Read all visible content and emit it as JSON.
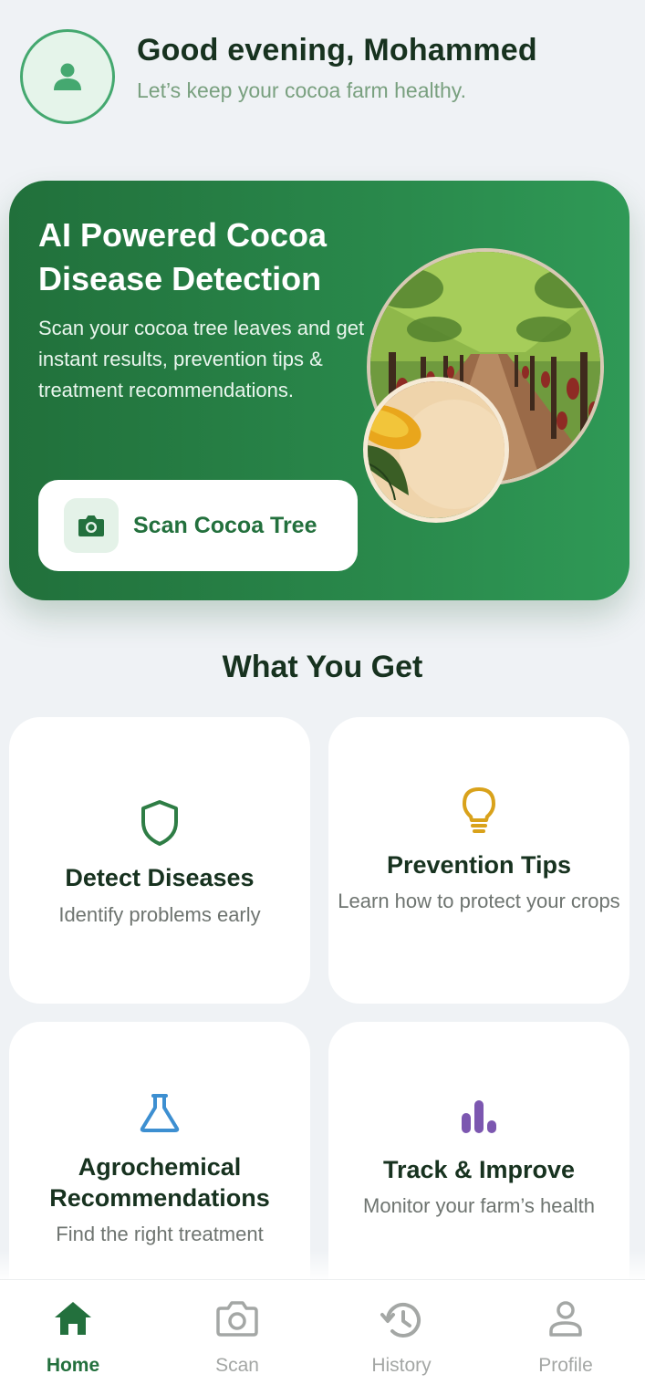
{
  "header": {
    "greeting": "Good evening, Mohammed",
    "subtitle": "Let’s keep your cocoa farm healthy.",
    "avatar_icon": "user-icon"
  },
  "hero": {
    "title_line1": "AI Powered Cocoa",
    "title_line2": "Disease Detection",
    "description": "Scan your cocoa tree leaves and get instant results, prevention tips & treatment recommendations.",
    "button_label": "Scan Cocoa Tree",
    "button_icon": "camera-icon",
    "colors": {
      "gradient_start": "#21703b",
      "gradient_end": "#2f9956"
    }
  },
  "features": {
    "title": "What You Get",
    "cards": [
      {
        "icon": "shield-icon",
        "icon_color": "#2e7d45",
        "title": "Detect Diseases",
        "description": "Identify problems early"
      },
      {
        "icon": "lightbulb-icon",
        "icon_color": "#d9a21b",
        "title": "Prevention Tips",
        "description": "Learn how to protect your crops"
      },
      {
        "icon": "flask-icon",
        "icon_color": "#3d8fd1",
        "title_line1": "Agrochemical",
        "title_line2": "Recommendations",
        "description": "Find the right treatment"
      },
      {
        "icon": "bar-chart-icon",
        "icon_color": "#7c57b0",
        "title": "Track & Improve",
        "description": "Monitor your farm’s health"
      }
    ]
  },
  "bottom_nav": {
    "active": "Home",
    "items": [
      {
        "label": "Home",
        "icon": "home-icon"
      },
      {
        "label": "Scan",
        "icon": "camera-icon"
      },
      {
        "label": "History",
        "icon": "history-icon"
      },
      {
        "label": "Profile",
        "icon": "profile-icon"
      }
    ]
  },
  "colors": {
    "accent": "#23703d",
    "background": "#eff2f5",
    "text_primary": "#17321f",
    "text_muted": "#79a07f",
    "nav_inactive": "#a4a7a5"
  }
}
